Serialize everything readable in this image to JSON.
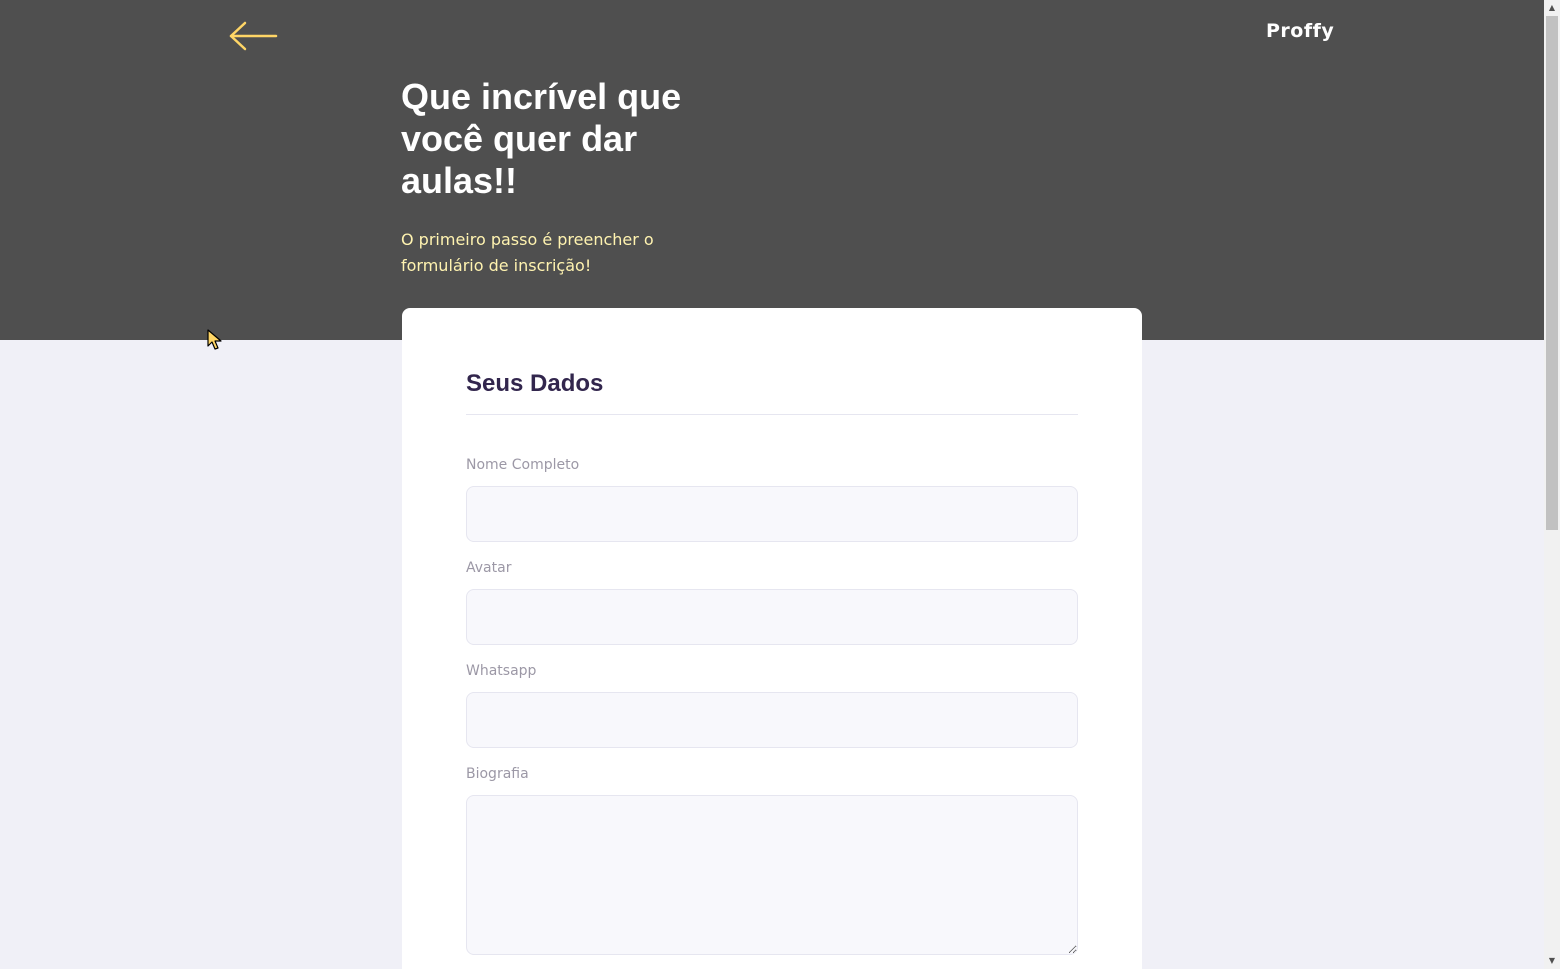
{
  "header": {
    "back_icon": "arrow-left-icon",
    "brand": "Proffy",
    "title": "Que incrível que você quer dar aulas!!",
    "subtitle": "O primeiro passo é preencher o formulário de inscrição!"
  },
  "form": {
    "section_title": "Seus Dados",
    "fields": [
      {
        "label": "Nome Completo",
        "value": ""
      },
      {
        "label": "Avatar",
        "value": ""
      },
      {
        "label": "Whatsapp",
        "value": ""
      },
      {
        "label": "Biografia",
        "value": ""
      }
    ]
  },
  "colors": {
    "header_bg": "#4f4f4f",
    "page_bg": "#f0f0f7",
    "accent_yellow": "#ffd666",
    "title_purple": "#32264d",
    "label_gray": "#9c98a6"
  }
}
